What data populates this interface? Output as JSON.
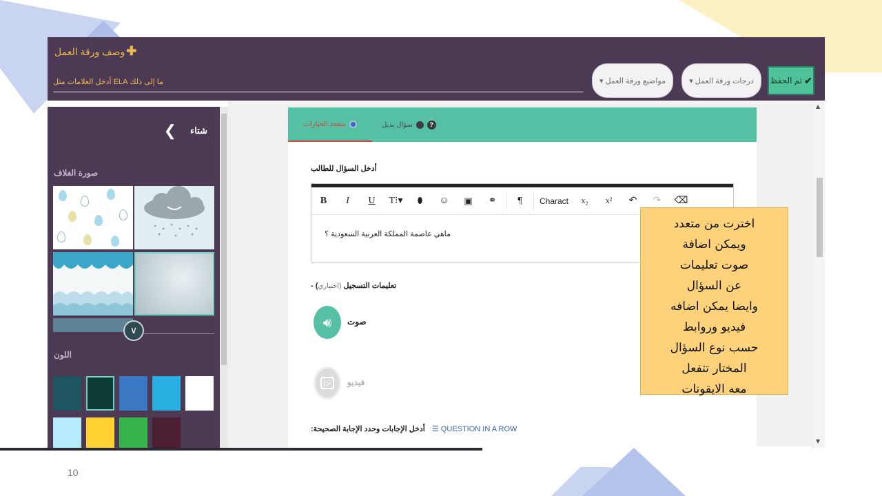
{
  "slide": {
    "page_number": "10"
  },
  "header": {
    "title": "وصف ورقة العمل",
    "tags_placeholder": "ما إلى ذلك ELA أدخل العلامات مثل",
    "topics_label": "مواضيع ورقة العمل",
    "grades_label": "درجات ورقة العمل",
    "save_label": "تم الحفظ"
  },
  "sidebar": {
    "theme_name": "شتاء",
    "cover_label": "صورة الغلاف",
    "color_label": "اللون",
    "swatches": [
      "#1f5561",
      "#0d3d36",
      "#3b78c4",
      "#28aee0",
      "#ffffff",
      "#b6eafd",
      "#fed233",
      "#38b54a",
      "#4c1f35"
    ]
  },
  "question": {
    "tab_multiple": "متعدد الخيارات",
    "tab_alternative": "سؤال بديل",
    "prompt_label": "أدخل السؤال للطالب",
    "editor_text": "ماهي عاصمة المملكة العربية السعودية ؟",
    "toolbar_character": "Charact",
    "recording_label": "- (تعليمات التسجيل",
    "recording_optional": "(اختياري",
    "audio_label": "صوت",
    "video_label": "فيديو",
    "answers_label": ":أدخل الإجابات وحدد الإجابة الصحيحة",
    "question_in_row": "QUESTION IN A ROW"
  },
  "callout": {
    "lines": [
      "اخترت من متعدد",
      "ويمكن اضافة",
      "صوت تعليمات",
      "عن السؤال",
      "وايضا يمكن اضافه",
      "فيديو وروابط",
      "حسب نوع السؤال",
      "المختار تتفعل",
      "معه الايقونات"
    ]
  }
}
